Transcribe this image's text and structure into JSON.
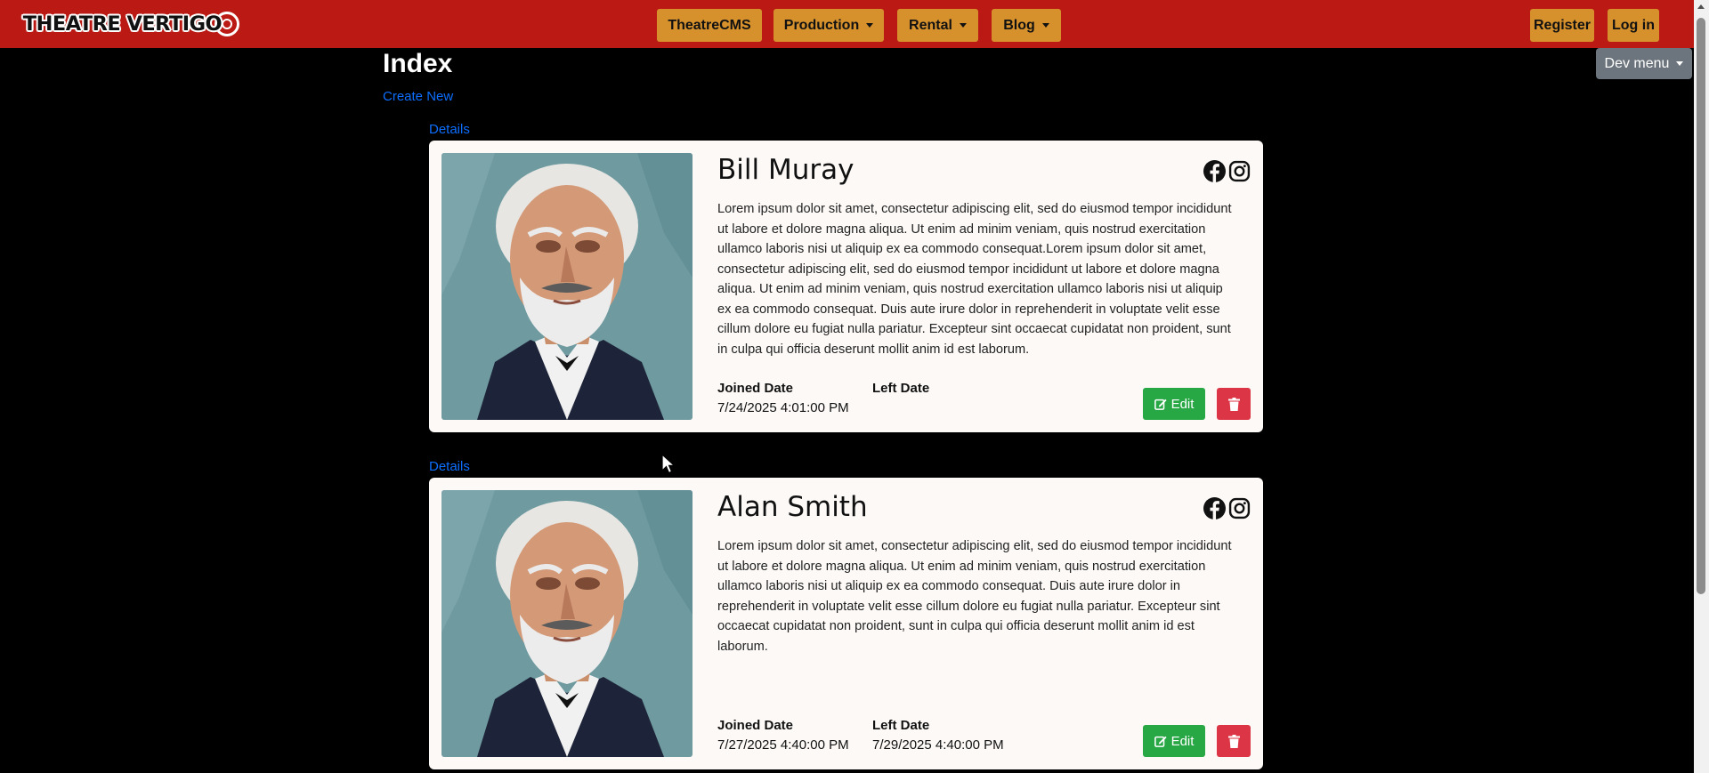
{
  "navbar": {
    "logo_text": "THEATRE VERTIGO",
    "theatrecms_label": "TheatreCMS",
    "production_label": "Production",
    "rental_label": "Rental",
    "blog_label": "Blog",
    "register_label": "Register",
    "login_label": "Log in"
  },
  "dev_menu_label": "Dev menu",
  "page": {
    "title": "Index",
    "create_new": "Create New"
  },
  "colors": {
    "navbar_bg": "#bb1a14",
    "nav_button": "#d6912d",
    "link": "#0d6efd",
    "edit": "#28a745",
    "delete": "#dc3545"
  },
  "members": [
    {
      "details_label": "Details",
      "name": "Bill Muray",
      "bio": "Lorem ipsum dolor sit amet, consectetur adipiscing elit, sed do eiusmod tempor incididunt ut labore et dolore magna aliqua. Ut enim ad minim veniam, quis nostrud exercitation ullamco laboris nisi ut aliquip ex ea commodo consequat.Lorem ipsum dolor sit amet, consectetur adipiscing elit, sed do eiusmod tempor incididunt ut labore et dolore magna aliqua. Ut enim ad minim veniam, quis nostrud exercitation ullamco laboris nisi ut aliquip ex ea commodo consequat. Duis aute irure dolor in reprehenderit in voluptate velit esse cillum dolore eu fugiat nulla pariatur. Excepteur sint occaecat cupidatat non proident, sunt in culpa qui officia deserunt mollit anim id est laborum.",
      "joined_label": "Joined Date",
      "joined_value": "7/24/2025 4:01:00 PM",
      "left_label": "Left Date",
      "left_value": "",
      "edit_label": "Edit"
    },
    {
      "details_label": "Details",
      "name": "Alan Smith",
      "bio": "Lorem ipsum dolor sit amet, consectetur adipiscing elit, sed do eiusmod tempor incididunt ut labore et dolore magna aliqua. Ut enim ad minim veniam, quis nostrud exercitation ullamco laboris nisi ut aliquip ex ea commodo consequat. Duis aute irure dolor in reprehenderit in voluptate velit esse cillum dolore eu fugiat nulla pariatur. Excepteur sint occaecat cupidatat non proident, sunt in culpa qui officia deserunt mollit anim id est laborum.",
      "joined_label": "Joined Date",
      "joined_value": "7/27/2025 4:40:00 PM",
      "left_label": "Left Date",
      "left_value": "7/29/2025 4:40:00 PM",
      "edit_label": "Edit"
    }
  ]
}
